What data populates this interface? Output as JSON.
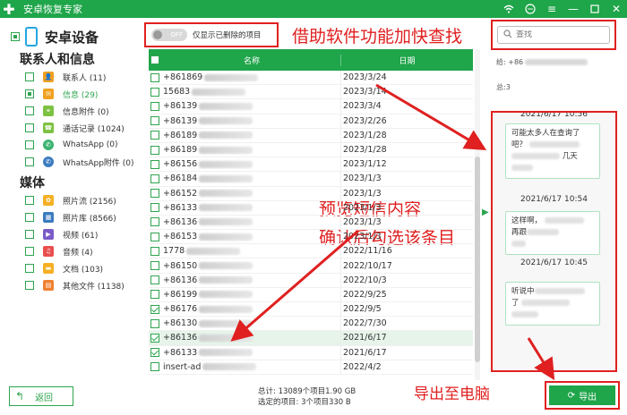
{
  "app": {
    "title": "安卓恢复专家"
  },
  "sidebar": {
    "device_label": "安卓设备",
    "sections": [
      {
        "title": "联系人和信息",
        "items": [
          {
            "label": "联系人 (11)",
            "icon": "contacts-icon",
            "color": "#f0a020"
          },
          {
            "label": "信息 (29)",
            "icon": "messages-icon",
            "color": "#f0a020",
            "active": true
          },
          {
            "label": "信息附件 (0)",
            "icon": "attachment-icon",
            "color": "#7dc242"
          },
          {
            "label": "通话记录 (1024)",
            "icon": "call-log-icon",
            "color": "#7dc242"
          },
          {
            "label": "WhatsApp (0)",
            "icon": "whatsapp-icon",
            "color": "#3cb371"
          },
          {
            "label": "WhatsApp附件 (0)",
            "icon": "whatsapp-attachment-icon",
            "color": "#3a7bbf"
          }
        ]
      },
      {
        "title": "媒体",
        "items": [
          {
            "label": "照片流 (2156)",
            "icon": "photo-stream-icon",
            "color": "#f5b025"
          },
          {
            "label": "照片库 (8566)",
            "icon": "photo-library-icon",
            "color": "#3a7bbf"
          },
          {
            "label": "视频 (61)",
            "icon": "video-icon",
            "color": "#7b5bc7"
          },
          {
            "label": "音频 (4)",
            "icon": "audio-icon",
            "color": "#e94f4f"
          },
          {
            "label": "文档 (103)",
            "icon": "document-icon",
            "color": "#f5b025"
          },
          {
            "label": "其他文件 (1138)",
            "icon": "other-files-icon",
            "color": "#f08030"
          }
        ]
      }
    ],
    "back_label": "返回"
  },
  "filter": {
    "toggle_text": "OFF",
    "label": "仅显示已删除的项目"
  },
  "search": {
    "placeholder": "查找"
  },
  "annotations": {
    "a1": "借助软件功能加快查找",
    "a2_line1": "预览短信内容",
    "a2_line2": "确认后勾选该条目",
    "a3": "导出至电脑"
  },
  "table": {
    "headers": {
      "name": "名称",
      "date": "日期"
    },
    "rows": [
      {
        "name": "+861869",
        "date": "2023/3/24",
        "checked": false
      },
      {
        "name": "15683",
        "date": "2023/3/14",
        "checked": false
      },
      {
        "name": "+86139",
        "date": "2023/3/4",
        "checked": false
      },
      {
        "name": "+86139",
        "date": "2023/2/26",
        "checked": false
      },
      {
        "name": "+86189",
        "date": "2023/1/28",
        "checked": false
      },
      {
        "name": "+86189",
        "date": "2023/1/28",
        "checked": false
      },
      {
        "name": "+86156",
        "date": "2023/1/12",
        "checked": false
      },
      {
        "name": "+86184",
        "date": "2023/1/3",
        "checked": false
      },
      {
        "name": "+86152",
        "date": "2023/1/3",
        "checked": false
      },
      {
        "name": "+86133",
        "date": "2023/1/3",
        "checked": false
      },
      {
        "name": "+86136",
        "date": "2023/1/3",
        "checked": false
      },
      {
        "name": "+86153",
        "date": "2023/1/3",
        "checked": false
      },
      {
        "name": "1778",
        "date": "2022/11/16",
        "checked": false
      },
      {
        "name": "+86150",
        "date": "2022/10/17",
        "checked": false
      },
      {
        "name": "+86136",
        "date": "2022/10/3",
        "checked": false
      },
      {
        "name": "+86199",
        "date": "2022/9/25",
        "checked": false
      },
      {
        "name": "+86176",
        "date": "2022/9/5",
        "checked": true
      },
      {
        "name": "+86130",
        "date": "2022/7/30",
        "checked": false
      },
      {
        "name": "+86136",
        "date": "2021/6/17",
        "checked": true,
        "selected": true
      },
      {
        "name": "+86133",
        "date": "2021/6/17",
        "checked": true
      },
      {
        "name": "insert-ad",
        "date": "2022/4/2",
        "checked": false
      }
    ]
  },
  "summary": {
    "total": "总计: 13089个项目1.90 GB",
    "selected": "选定的项目: 3个项目330 B"
  },
  "preview": {
    "to_label": "给: +86",
    "total_label": "总:3",
    "messages": [
      {
        "time": "2021/6/17 10:56",
        "text_a": "可能太多人在查询了",
        "text_b": "吧？",
        "text_c": "几天"
      },
      {
        "time": "2021/6/17 10:54",
        "text_a": "这样啊，",
        "text_b": "再跟"
      },
      {
        "time": "2021/6/17 10:45",
        "text_a": "听说中",
        "text_b": "了"
      }
    ]
  },
  "export": {
    "label": "导出"
  },
  "colors": {
    "brand": "#1fa54a",
    "annotation": "#e02020"
  }
}
